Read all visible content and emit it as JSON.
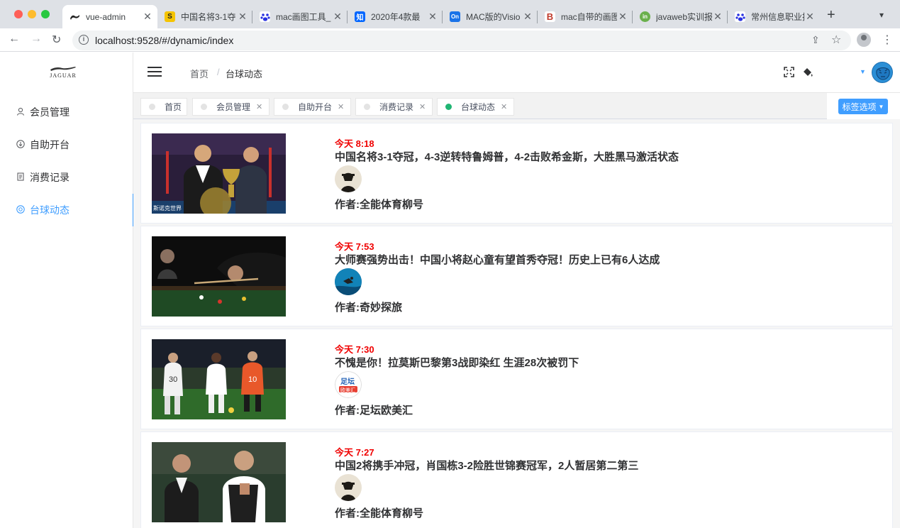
{
  "browser": {
    "tabs": [
      {
        "title": "vue-admin",
        "icon": "jaguar-favicon",
        "color": "#222222"
      },
      {
        "title": "中国名将3-1夺",
        "icon": "s-favicon",
        "color": "#f5c400"
      },
      {
        "title": "mac画图工具_",
        "icon": "baidu-paw-favicon",
        "color": "#2932e1"
      },
      {
        "title": "2020年4款最",
        "icon": "zhihu-favicon",
        "color": "#0066ff"
      },
      {
        "title": "MAC版的Visio",
        "icon": "on-favicon",
        "color": "#1a73e8"
      },
      {
        "title": "mac自带的画图",
        "icon": "b-favicon",
        "color": "#c0392b"
      },
      {
        "title": "javaweb实训报",
        "icon": "in-favicon",
        "color": "#6ab04c"
      },
      {
        "title": "常州信息职业技",
        "icon": "baidu-paw-favicon",
        "color": "#2932e1"
      }
    ],
    "url": "localhost:9528/#/dynamic/index"
  },
  "brand": {
    "logo_text": "JAGUAR"
  },
  "sidebar": {
    "items": [
      {
        "label": "会员管理",
        "icon": "user-icon"
      },
      {
        "label": "自助开台",
        "icon": "download-circle-icon"
      },
      {
        "label": "消费记录",
        "icon": "document-icon"
      },
      {
        "label": "台球动态",
        "icon": "billiard-icon"
      }
    ],
    "active_index": 3
  },
  "breadcrumb": {
    "home": "首页",
    "separator": "/",
    "current": "台球动态"
  },
  "tags": [
    {
      "label": "首页",
      "closable": false
    },
    {
      "label": "会员管理",
      "closable": true
    },
    {
      "label": "自助开台",
      "closable": true
    },
    {
      "label": "消费记录",
      "closable": true
    },
    {
      "label": "台球动态",
      "closable": true,
      "active": true
    }
  ],
  "tag_options_label": "标签选项",
  "posts": [
    {
      "time": "今天 8:18",
      "title": "中国名将3-1夺冠，4-3逆转特鲁姆普，4-2击败希金斯，大胜黑马激活状态",
      "author": "作者:全能体育柳号"
    },
    {
      "time": "今天 7:53",
      "title": "大师赛强势出击！中国小将赵心童有望首秀夺冠！历史上已有6人达成",
      "author": "作者:奇妙探旅"
    },
    {
      "time": "今天 7:30",
      "title": "不愧是你！拉莫斯巴黎第3战即染红 生涯28次被罚下",
      "author": "作者:足坛欧美汇"
    },
    {
      "time": "今天 7:27",
      "title": "中国2将携手冲冠，肖国栋3-2险胜世锦赛冠军，2人暂居第二第三",
      "author": "作者:全能体育柳号"
    }
  ],
  "colors": {
    "accent": "#409eff",
    "time_red": "#f00000",
    "active_tag_dot": "#20b573"
  }
}
